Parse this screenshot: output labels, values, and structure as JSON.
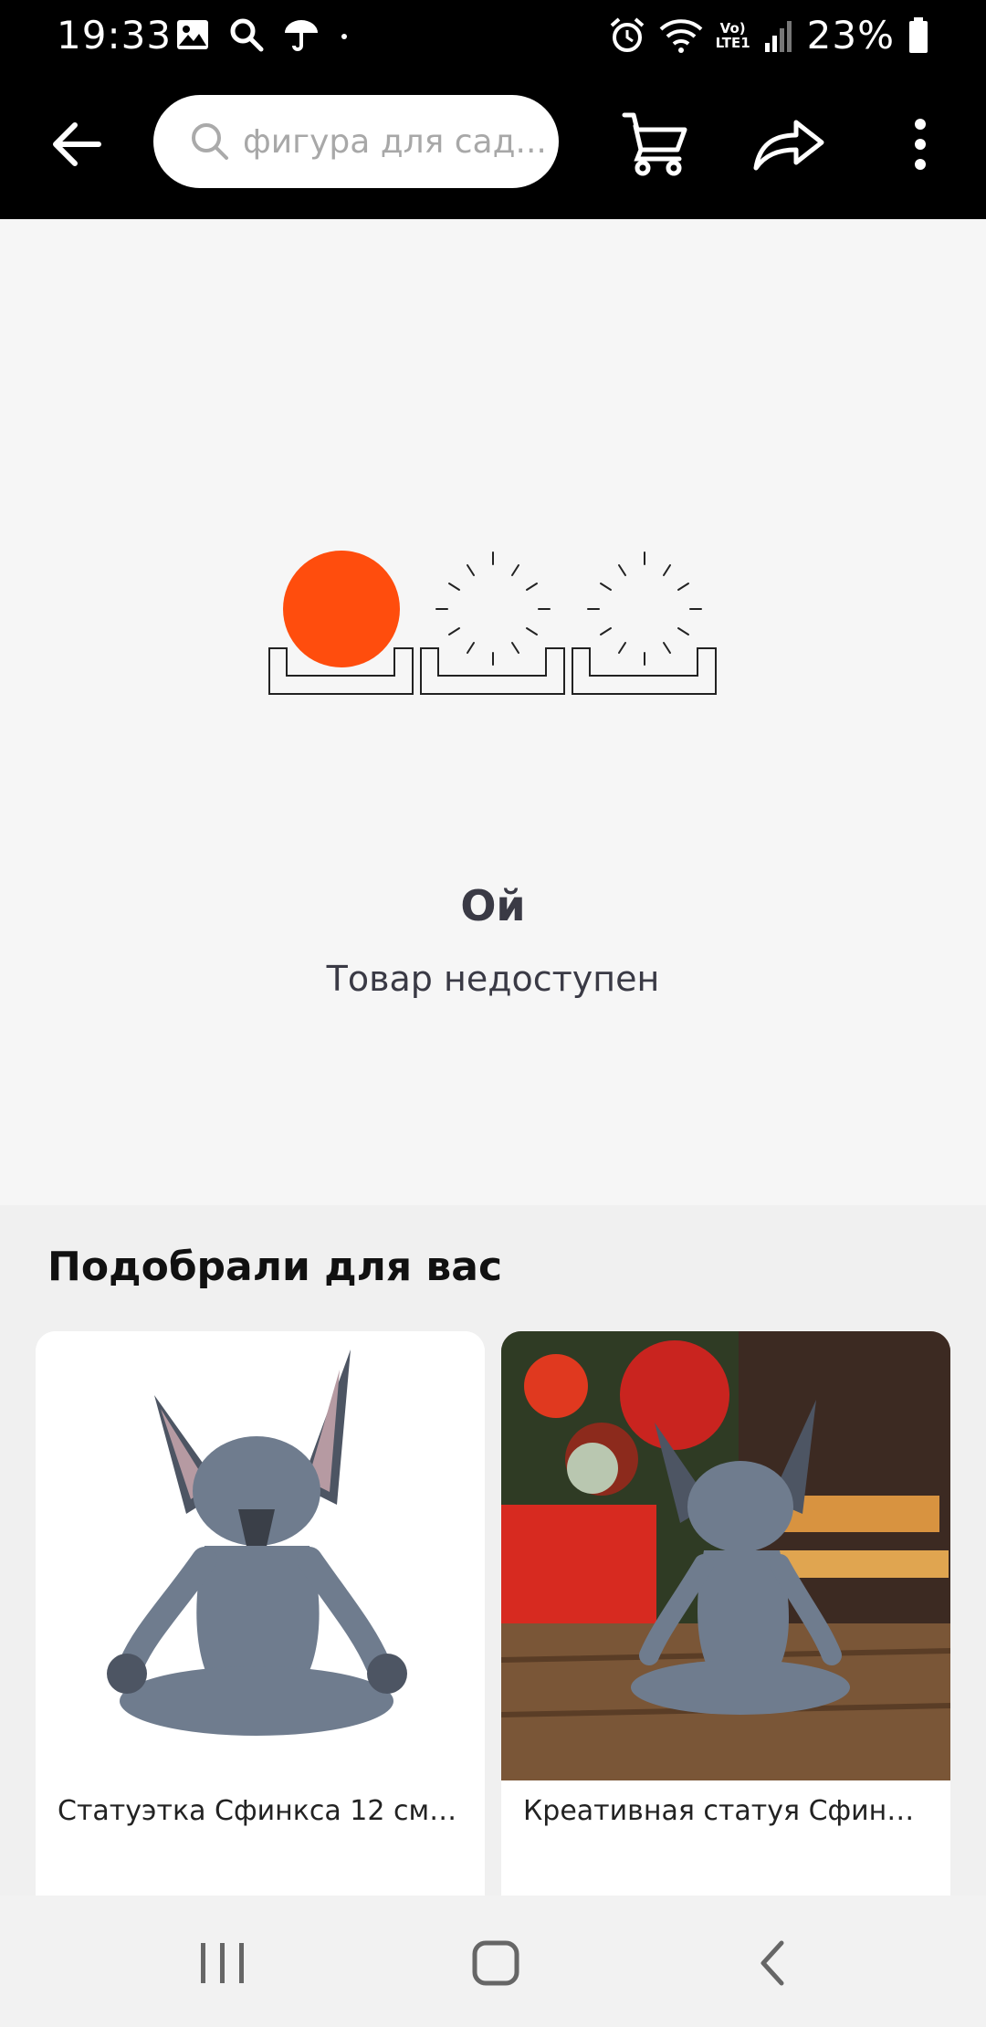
{
  "status_bar": {
    "time": "19:33",
    "battery_percent": "23%",
    "network_label_top": "Vo)",
    "network_label_bottom": "LTE1"
  },
  "toolbar": {
    "search_placeholder": "фигура для сад...",
    "icons": [
      "back-arrow-icon",
      "cart-icon",
      "share-icon",
      "more-vert-icon"
    ]
  },
  "error": {
    "title": "Ой",
    "subtitle": "Товар недоступен",
    "accent_color": "#ff4d0d"
  },
  "recommendations": {
    "title": "Подобрали для вас",
    "items": [
      {
        "title": "Статуэтка Сфинкса 12 см, м..."
      },
      {
        "title": "Креативная статуя Сфинкса..."
      }
    ]
  },
  "nav_bar": {
    "icons": [
      "recent-apps-icon",
      "home-icon",
      "nav-back-icon"
    ]
  }
}
